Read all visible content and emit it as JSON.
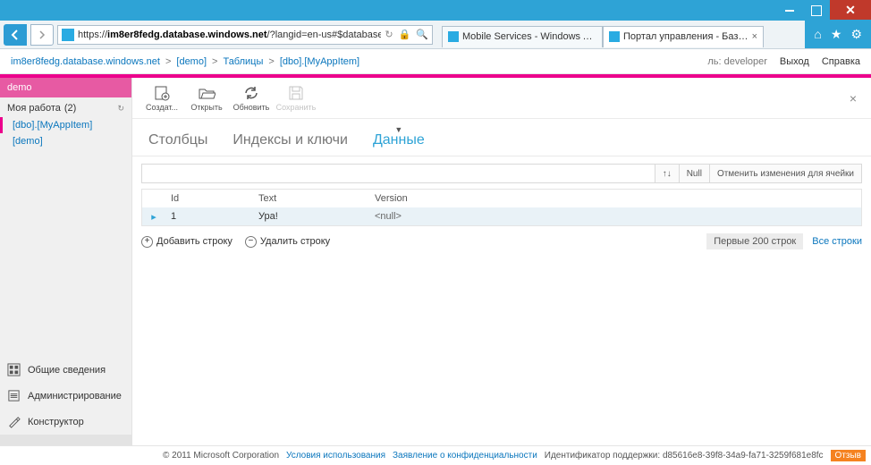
{
  "browser": {
    "url_host": "im8er8fedg.database.windows.net",
    "url_prefix": "https://",
    "url_path": "/?langid=en-us#$database=demo&entity=Table&",
    "tabs": [
      {
        "title": "Mobile Services - Windows Azure",
        "active": false
      },
      {
        "title": "Портал управления - База д...",
        "active": true
      }
    ]
  },
  "breadcrumb": {
    "root": "im8er8fedg.database.windows.net",
    "parts": [
      "[demo]",
      "Таблицы",
      "[dbo].[MyAppItem]"
    ]
  },
  "header": {
    "role_prefix": "ль:",
    "role": "developer",
    "logout": "Выход",
    "help": "Справка"
  },
  "sidebar": {
    "db_name": "demo",
    "group_label": "Моя работа",
    "group_count": "(2)",
    "items": [
      {
        "label": "[dbo].[MyAppItem]",
        "active": true
      },
      {
        "label": "[demo]",
        "active": false
      }
    ],
    "nav": [
      {
        "label": "Общие сведения",
        "icon": "dashboard"
      },
      {
        "label": "Администрирование",
        "icon": "admin"
      },
      {
        "label": "Конструктор",
        "icon": "designer"
      }
    ]
  },
  "toolbar": {
    "items": [
      {
        "name": "new",
        "label": "Создат...",
        "disabled": false
      },
      {
        "name": "open",
        "label": "Открыть",
        "disabled": false
      },
      {
        "name": "refresh",
        "label": "Обновить",
        "disabled": false
      },
      {
        "name": "save",
        "label": "Сохранить",
        "disabled": true
      }
    ]
  },
  "page_tabs": [
    {
      "label": "Столбцы",
      "active": false
    },
    {
      "label": "Индексы и ключи",
      "active": false
    },
    {
      "label": "Данные",
      "active": true
    }
  ],
  "filterbar": {
    "sort_label": "↑↓",
    "null_label": "Null",
    "revert_label": "Отменить изменения для ячейки"
  },
  "grid": {
    "columns": [
      "Id",
      "Text",
      "Version"
    ],
    "rows": [
      {
        "Id": "1",
        "Text": "Ура!",
        "Version": "<null>"
      }
    ]
  },
  "row_actions": {
    "add": "Добавить строку",
    "delete": "Удалить строку",
    "first200": "Первые 200 строк",
    "all": "Все строки"
  },
  "footer": {
    "copyright": "© 2011 Microsoft Corporation",
    "terms": "Условия использования",
    "privacy": "Заявление о конфиденциальности",
    "support_label": "Идентификатор поддержки:",
    "support_id": "d85616e8-39f8-34a9-fa71-3259f681e8fc",
    "feedback": "Отзыв"
  }
}
